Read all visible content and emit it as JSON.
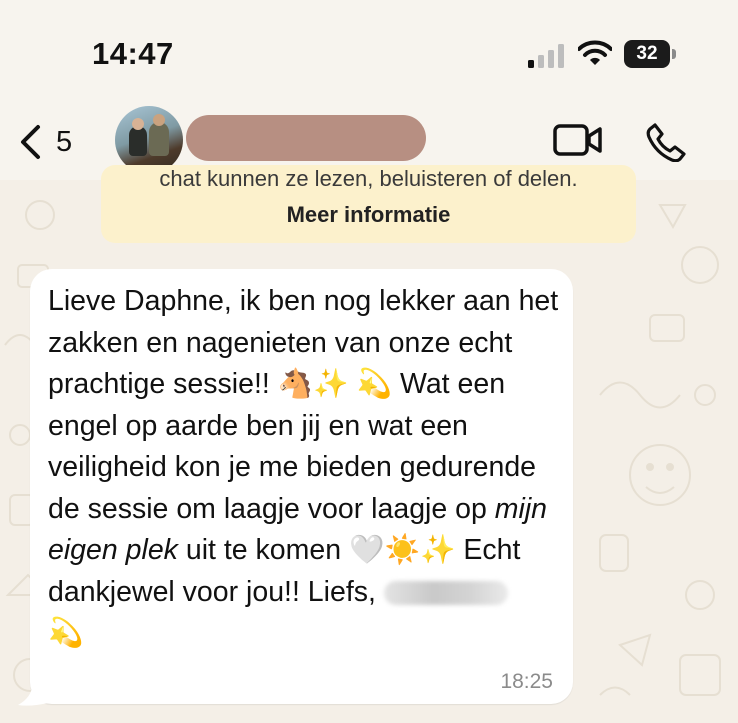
{
  "status_bar": {
    "time": "14:47",
    "battery": "32"
  },
  "header": {
    "back_count": "5"
  },
  "notice": {
    "clipped_text": "chat kunnen ze lezen, beluisteren of delen.",
    "link": "Meer informatie"
  },
  "message": {
    "segments": [
      "Lieve Daphne, ik ben nog lekker aan het zakken en nagenieten van onze echt prachtige sessie!! 🐴✨ 💫 Wat een engel op aarde ben jij en wat een veiligheid kon je me bieden gedurende de sessie om laagje voor laagje op ",
      "mijn eigen plek",
      " uit te komen 🤍☀️✨ Echt dankjewel voor jou!! Liefs, ",
      " 💫"
    ],
    "time": "18:25"
  },
  "colors": {
    "background": "#f4efe7",
    "notice_bg": "#fcf1cc",
    "bubble_bg": "#ffffff",
    "redaction": "#b78f82"
  }
}
